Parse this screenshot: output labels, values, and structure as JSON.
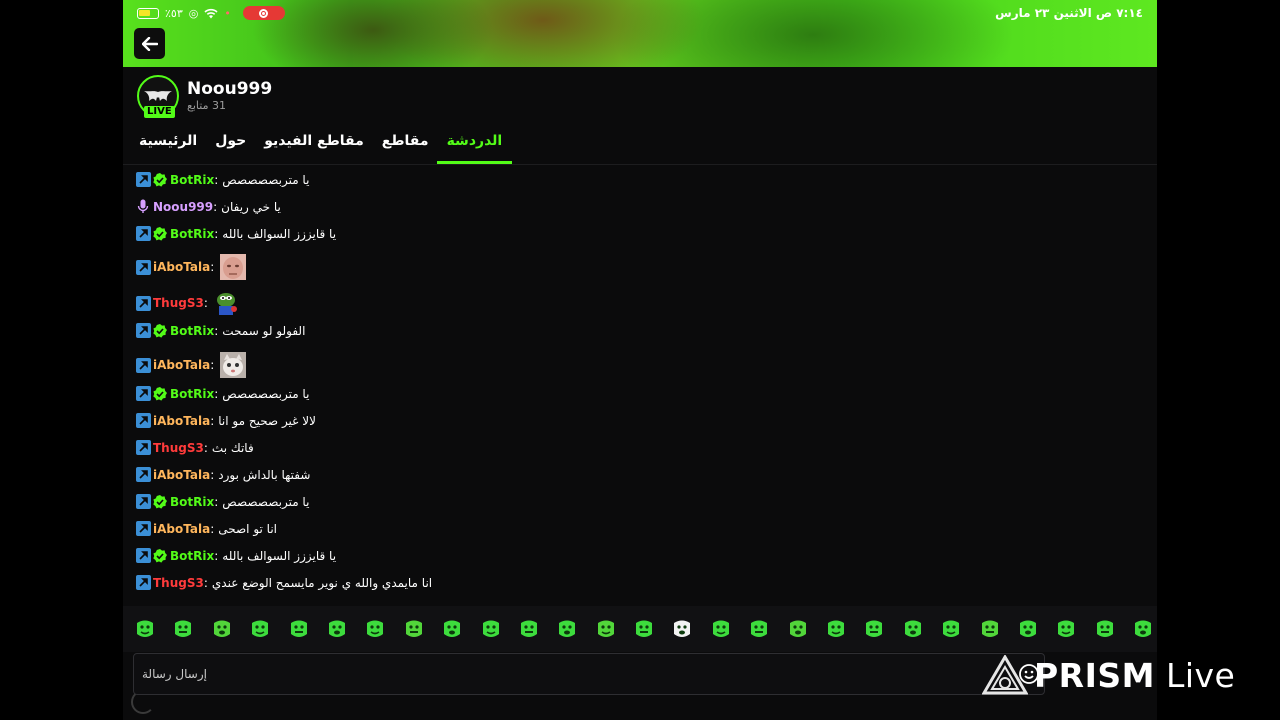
{
  "status_bar": {
    "time_date": "٧:١٤ ص  الاثنين ٢٣ مارس",
    "battery": "٪٥٣",
    "wifi_icon": "wifi-icon",
    "record_icon": "record-icon"
  },
  "channel": {
    "name": "Noou999",
    "followers": "31 متابع",
    "live_badge": "LIVE"
  },
  "tabs": [
    {
      "label": "الدردشة",
      "active": true
    },
    {
      "label": "مقاطع",
      "active": false
    },
    {
      "label": "مقاطع الفيديو",
      "active": false
    },
    {
      "label": "حول",
      "active": false
    },
    {
      "label": "الرئيسية",
      "active": false
    }
  ],
  "chat": [
    {
      "user": "BotRix",
      "color": "#53fc18",
      "badges": [
        "mod",
        "verified"
      ],
      "text": "يا متربصصصصص"
    },
    {
      "user": "Noou999",
      "color": "#d7a0ff",
      "badges": [
        "broadcaster"
      ],
      "text": "يا خي ريفان"
    },
    {
      "user": "BotRix",
      "color": "#53fc18",
      "badges": [
        "mod",
        "verified"
      ],
      "text": "يا قايززز السوالف بالله"
    },
    {
      "user": "iAboTala",
      "color": "#ffb65c",
      "badges": [
        "mod"
      ],
      "text": "",
      "emote": "face-emote"
    },
    {
      "user": "ThugS3",
      "color": "#ff3b3b",
      "badges": [
        "mod"
      ],
      "text": "",
      "emote": "pepe-emote"
    },
    {
      "user": "BotRix",
      "color": "#53fc18",
      "badges": [
        "mod",
        "verified"
      ],
      "text": "الفولو لو سمحت"
    },
    {
      "user": "iAboTala",
      "color": "#ffb65c",
      "badges": [
        "mod"
      ],
      "text": "",
      "emote": "cat-emote"
    },
    {
      "user": "BotRix",
      "color": "#53fc18",
      "badges": [
        "mod",
        "verified"
      ],
      "text": "يا متربصصصصص"
    },
    {
      "user": "iAboTala",
      "color": "#ffb65c",
      "badges": [
        "mod"
      ],
      "text": "لالا غير صحيح مو انا"
    },
    {
      "user": "ThugS3",
      "color": "#ff3b3b",
      "badges": [
        "mod"
      ],
      "text": "فاتك بث"
    },
    {
      "user": "iAboTala",
      "color": "#ffb65c",
      "badges": [
        "mod"
      ],
      "text": "شفتها بالداش بورد"
    },
    {
      "user": "BotRix",
      "color": "#53fc18",
      "badges": [
        "mod",
        "verified"
      ],
      "text": "يا متربصصصصص"
    },
    {
      "user": "iAboTala",
      "color": "#ffb65c",
      "badges": [
        "mod"
      ],
      "text": "انا تو اصحى"
    },
    {
      "user": "BotRix",
      "color": "#53fc18",
      "badges": [
        "mod",
        "verified"
      ],
      "text": "يا قايززز السوالف بالله"
    },
    {
      "user": "ThugS3",
      "color": "#ff3b3b",
      "badges": [
        "mod"
      ],
      "text": "انا مايمدي والله ي نوير مايسمح الوضع عندي"
    }
  ],
  "emote_bar": {
    "count": 27,
    "accent": "#3ddc3d"
  },
  "input": {
    "placeholder": "إرسال رسالة",
    "emoji_icon": "smile-icon"
  },
  "watermark": {
    "brand": "PRISM",
    "suffix": " Live"
  },
  "colors": {
    "accent": "#53fc18",
    "background": "#0b0b0c"
  }
}
